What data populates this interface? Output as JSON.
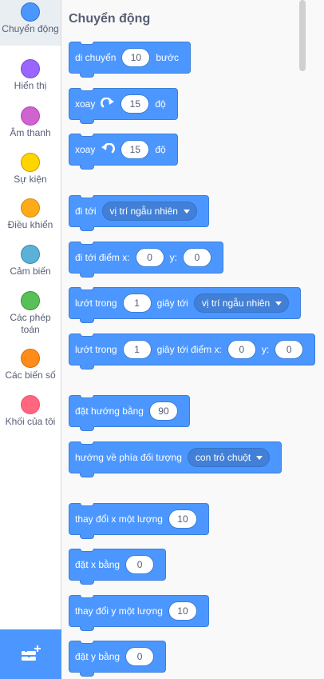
{
  "categories": [
    {
      "label": "Chuyển động",
      "color": "#4c97ff",
      "selected": true
    },
    {
      "label": "Hiển thị",
      "color": "#9966ff"
    },
    {
      "label": "Âm thanh",
      "color": "#cf63cf"
    },
    {
      "label": "Sự kiện",
      "color": "#ffd500"
    },
    {
      "label": "Điều khiển",
      "color": "#ffab19"
    },
    {
      "label": "Cảm biến",
      "color": "#5cb1d6"
    },
    {
      "label": "Các phép toán",
      "color": "#59c059"
    },
    {
      "label": "Các biến số",
      "color": "#ff8c1a"
    },
    {
      "label": "Khối của tôi",
      "color": "#ff6680"
    }
  ],
  "extension_button": {
    "icon": "add-extension-icon"
  },
  "palette": {
    "title": "Chuyển động",
    "blocks": {
      "move": {
        "text": "di chuyển",
        "value": "10",
        "suffix": "bước"
      },
      "turn_right": {
        "text": "xoay",
        "icon": "rotate-clockwise-icon",
        "value": "15",
        "suffix": "độ"
      },
      "turn_left": {
        "text": "xoay",
        "icon": "rotate-counterclockwise-icon",
        "value": "15",
        "suffix": "độ"
      },
      "goto": {
        "text": "đi tới",
        "dropdown": "vị trí ngẫu nhiên"
      },
      "goto_xy": {
        "text": "đi tới điểm x:",
        "x": "0",
        "ylabel": "y:",
        "y": "0"
      },
      "glide": {
        "text": "lướt trong",
        "value": "1",
        "mid": "giây tới",
        "dropdown": "vị trí ngẫu nhiên"
      },
      "glide_xy": {
        "text": "lướt trong",
        "value": "1",
        "mid": "giây tới điểm x:",
        "x": "0",
        "ylabel": "y:",
        "y": "0"
      },
      "point_direction": {
        "text": "đặt hướng bằng",
        "value": "90"
      },
      "point_towards": {
        "text": "hướng về phía đối tượng",
        "dropdown": "con trỏ chuột"
      },
      "change_x": {
        "text": "thay đổi x một lượng",
        "value": "10"
      },
      "set_x": {
        "text": "đặt x bằng",
        "value": "0"
      },
      "change_y": {
        "text": "thay đổi y một lượng",
        "value": "10"
      },
      "set_y": {
        "text": "đặt y bằng",
        "value": "0"
      }
    }
  },
  "colors": {
    "motion": "#4c97ff",
    "motion_border": "#3d7fd8",
    "text": "#575e75"
  }
}
